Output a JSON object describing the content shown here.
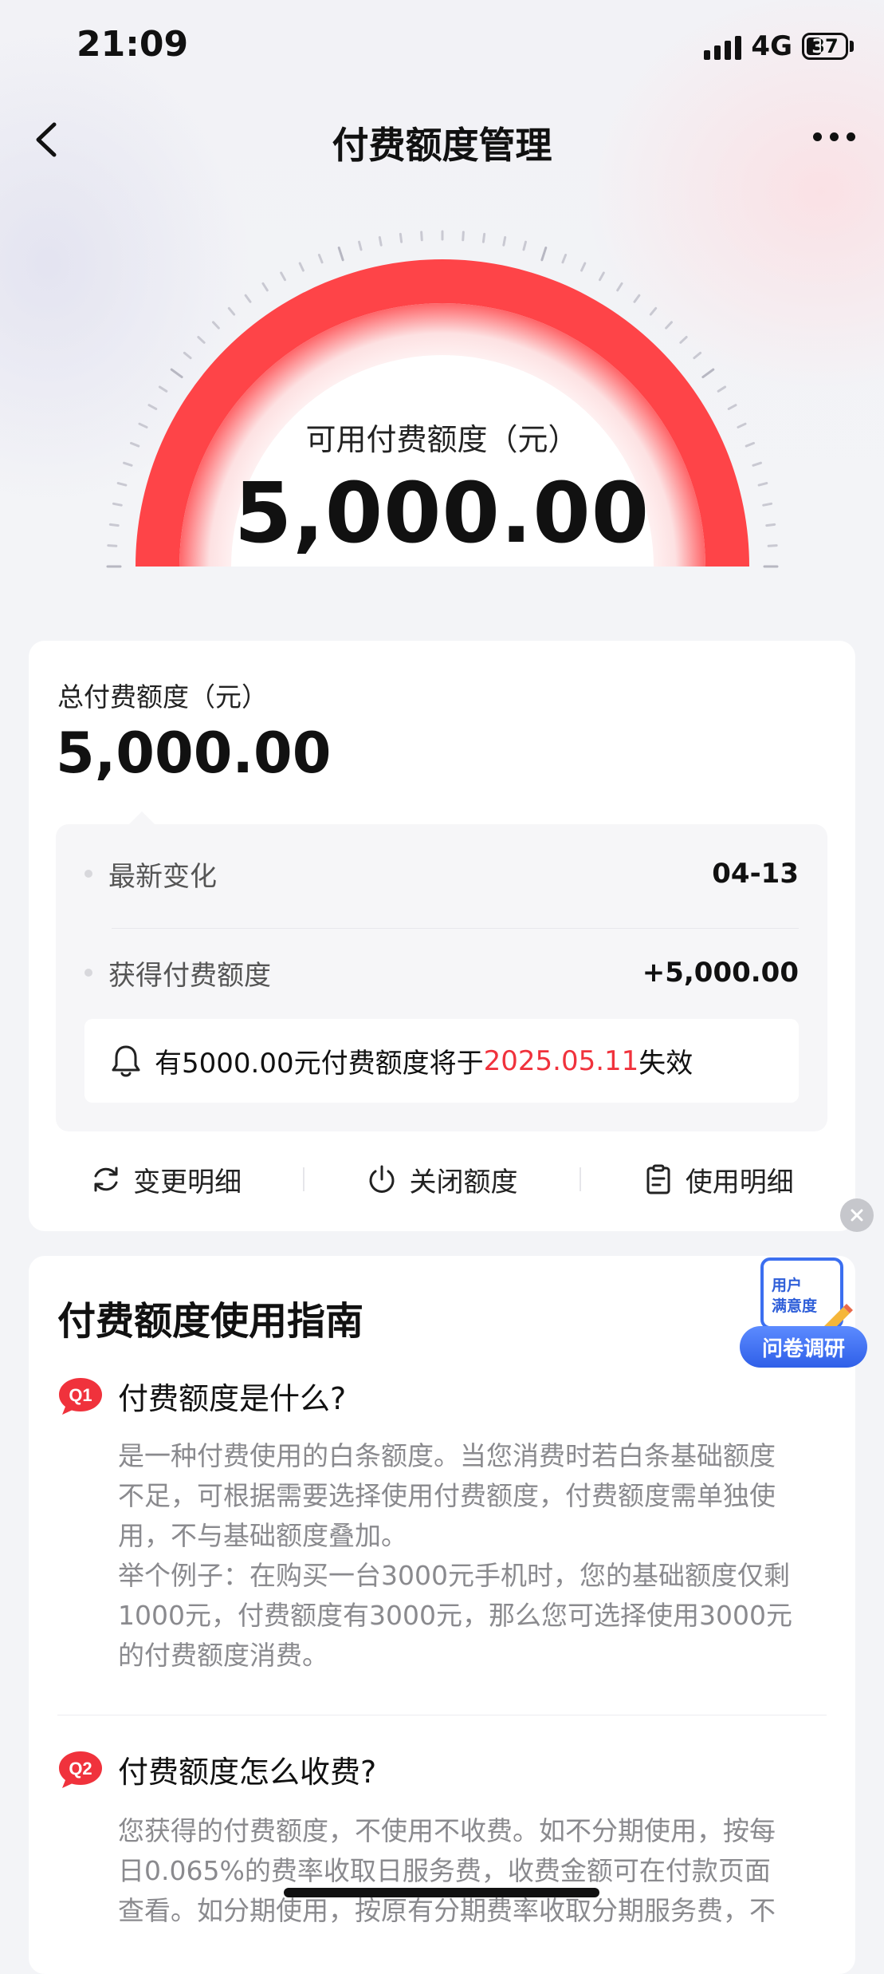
{
  "status_bar": {
    "time": "21:09",
    "network": "4G",
    "battery": "37"
  },
  "nav": {
    "title": "付费额度管理"
  },
  "gauge": {
    "label": "可用付费额度（元）",
    "value": "5,000.00"
  },
  "summary": {
    "total_label": "总付费额度（元）",
    "total_value": "5,000.00",
    "rows": [
      {
        "label": "最新变化",
        "value": "04-13"
      },
      {
        "label": "获得付费额度",
        "value": "+5,000.00"
      }
    ],
    "notice": {
      "prefix": "有5000.00元付费额度将于",
      "date": "2025.05.11",
      "suffix": "失效"
    },
    "actions": [
      {
        "label": "变更明细",
        "icon": "refresh-icon"
      },
      {
        "label": "关闭额度",
        "icon": "power-icon"
      },
      {
        "label": "使用明细",
        "icon": "clipboard-icon"
      }
    ]
  },
  "guide": {
    "title": "付费额度使用指南",
    "faqs": [
      {
        "badge": "Q1",
        "question": "付费额度是什么?",
        "answer_lines": [
          "是一种付费使用的白条额度。当您消费时若白条基础额度",
          "不足，可根据需要选择使用付费额度，付费额度需单独使",
          "用，不与基础额度叠加。",
          "举个例子：在购买一台3000元手机时，您的基础额度仅剩",
          "1000元，付费额度有3000元，那么您可选择使用3000元",
          "的付费额度消费。"
        ]
      },
      {
        "badge": "Q2",
        "question": "付费额度怎么收费?",
        "answer_lines": [
          "您获得的付费额度，不使用不收费。如不分期使用，按每",
          "日0.065%的费率收取日服务费，收费金额可在付款页面",
          "查看。如分期使用，按原有分期费率收取分期服务费，不"
        ]
      }
    ]
  },
  "survey": {
    "line1": "用户",
    "line2": "满意度",
    "button": "问卷调研"
  },
  "colors": {
    "accent_red": "#f0323c",
    "gauge_red": "#fe4448",
    "survey_blue": "#2f5fe8"
  }
}
